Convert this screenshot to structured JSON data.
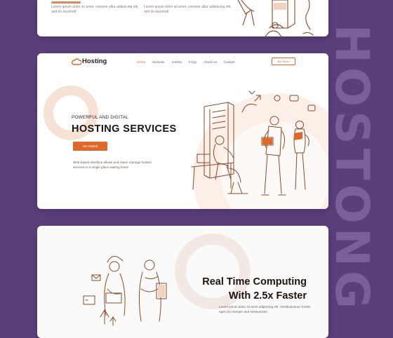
{
  "watermark": "HOSTONG",
  "card_top": {
    "desc_left": "Lorem ipsum dolor sit amet, consete altur adipiscing elit, sed do eiusmod",
    "desc_right": "Lorem ipsum dolor sit amet, consete altur adipiscing elit, sed do eiusmod"
  },
  "nav": {
    "logo_text": "Hosting",
    "links": [
      "Home",
      "Services",
      "Articles",
      "FAQs",
      "About Us",
      "Contact"
    ],
    "cta": "BUY NOW"
  },
  "hero": {
    "eyebrow": "POWERFUL AND DIGITAL",
    "title": "HOSTING SERVICES",
    "button": "Get Started",
    "description": "Web-based interface allows and return manage hosted services in a single place waiting hosts"
  },
  "section": {
    "title_line1": "Real Time Computing",
    "title_line2": "With 2.5x Faster",
    "description": "Lorem ipsum dolor sit amet adipiscing elit. Vestibulumnec fortels eget orci semper and vestuusvies."
  },
  "colors": {
    "background": "#5b3f7b",
    "accent": "#e0682b",
    "illustration": "#8a4a2a",
    "blob": "#f7e2d6"
  }
}
